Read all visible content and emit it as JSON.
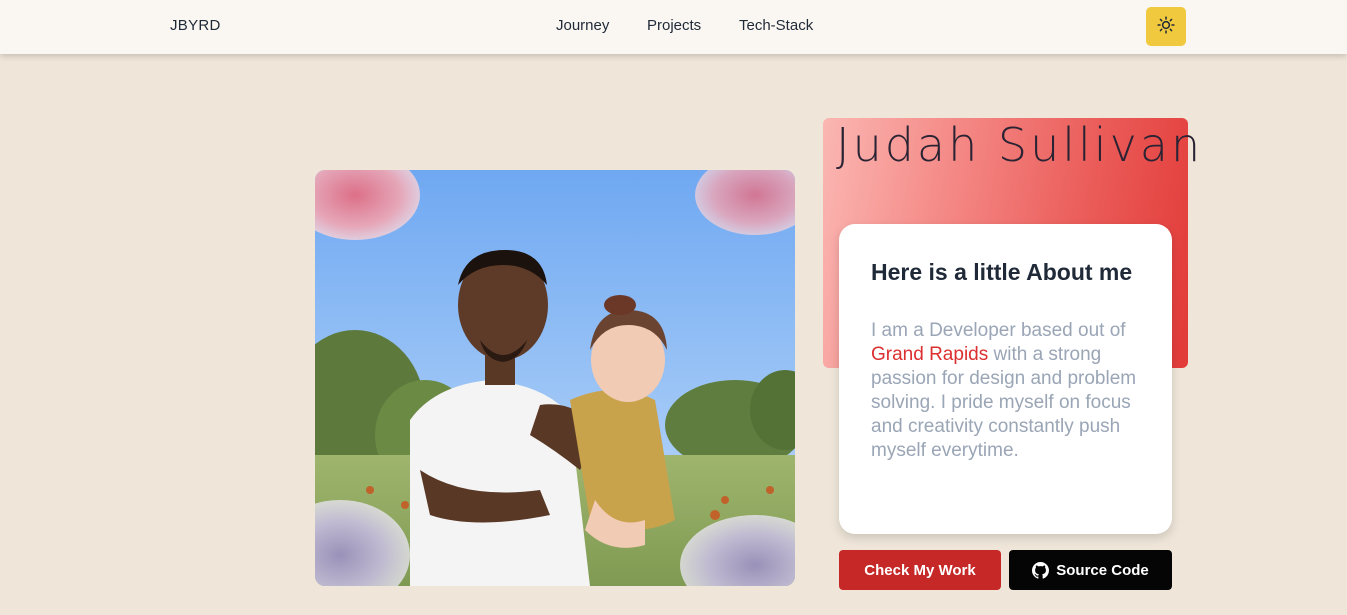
{
  "nav": {
    "brand": "JBYRD",
    "links": [
      "Journey",
      "Projects",
      "Tech-Stack"
    ],
    "theme_icon": "sun-icon",
    "theme_color": "#f0c93e"
  },
  "hero": {
    "name": "Judah Sullivan",
    "about_heading": "Here is a little About me",
    "about_body_before": "I am a Developer based out of ",
    "about_location": "Grand Rapids",
    "about_body_after": " with a strong passion for design and problem solving. I pride myself on focus and creativity constantly push myself everytime.",
    "photo_icon": "profile-photo",
    "accent_color": "#dc2f2f"
  },
  "buttons": {
    "work_label": "Check My Work",
    "source_label": "Source Code",
    "source_icon": "github-icon"
  }
}
